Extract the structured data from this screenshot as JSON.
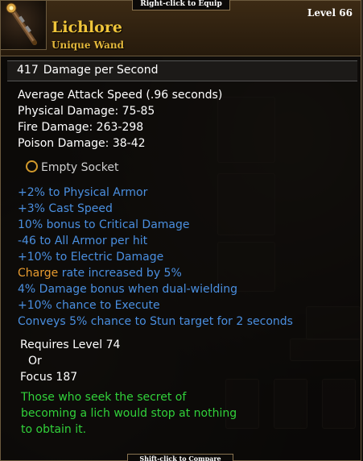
{
  "hints": {
    "top": "Right-click to Equip",
    "bottom": "Shift-click to Compare"
  },
  "item": {
    "name": "Lichlore",
    "type": "Unique Wand",
    "level": "Level 66"
  },
  "dps": {
    "value": "417",
    "label": "Damage per Second"
  },
  "stats": [
    "Average Attack Speed (.96 seconds)",
    "Physical Damage: 75-85",
    "Fire Damage: 263-298",
    "Poison Damage: 38-42"
  ],
  "socket": {
    "label": "Empty Socket"
  },
  "bonuses": [
    "+2% to Physical Armor",
    "+3% Cast Speed",
    "10% bonus to Critical Damage",
    "-46 to All Armor per hit",
    "+10% to Electric Damage",
    "rate increased by 5%",
    "4% Damage bonus when dual-wielding",
    "+10% chance to Execute",
    "Conveys 5% chance to Stun target for 2 seconds"
  ],
  "charge_word": "Charge",
  "requirements": {
    "level": "Requires Level 74",
    "or": "Or",
    "focus": "Focus 187"
  },
  "flavor": [
    "Those who seek the secret of",
    "becoming a lich would stop at nothing",
    "to obtain it."
  ],
  "colors": {
    "name": "#f0c53a",
    "bonus_blue": "#4a8fe0",
    "flavor_green": "#31d13a",
    "charge_orange": "#e89b2f"
  }
}
